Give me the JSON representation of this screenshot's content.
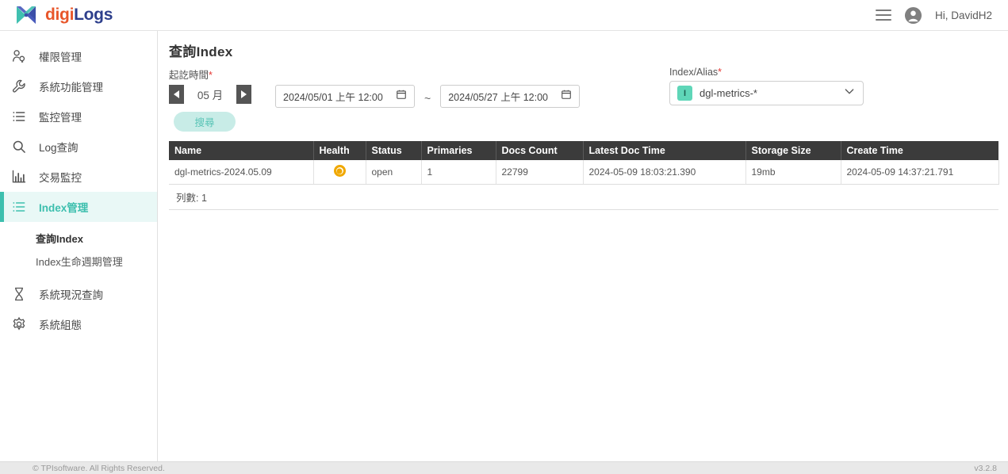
{
  "header": {
    "brand_part1": "digi",
    "brand_part2": "Logs",
    "greeting": "Hi, DavidH2",
    "menu_icon": "hamburger-icon",
    "user_icon": "account-circle-icon"
  },
  "sidebar": {
    "items": [
      {
        "label": "權限管理",
        "icon": "person-key-icon",
        "active": false
      },
      {
        "label": "系統功能管理",
        "icon": "wrench-icon",
        "active": false
      },
      {
        "label": "監控管理",
        "icon": "list-icon",
        "active": false
      },
      {
        "label": "Log查詢",
        "icon": "search-icon",
        "active": false
      },
      {
        "label": "交易監控",
        "icon": "bar-chart-icon",
        "active": false
      },
      {
        "label": "Index管理",
        "icon": "list-icon",
        "active": true
      }
    ],
    "sub_items": [
      {
        "label": "查詢Index",
        "active": true
      },
      {
        "label": "Index生命週期管理",
        "active": false
      }
    ],
    "items_after": [
      {
        "label": "系統現況查詢",
        "icon": "hourglass-icon",
        "active": false
      },
      {
        "label": "系統組態",
        "icon": "gear-icon",
        "active": false
      }
    ]
  },
  "main": {
    "title": "查詢Index",
    "time_label": "起訖時間",
    "required_mark": "*",
    "month_value": "05 月",
    "prev_arrow": "◀",
    "next_arrow": "▶",
    "search_button": "搜尋",
    "date_from": "2024/05/01 上午 12:00",
    "date_to": "2024/05/27 上午 12:00",
    "date_separator": "~",
    "alias_label": "Index/Alias",
    "alias_badge": "I",
    "alias_value": "dgl-metrics-*"
  },
  "table": {
    "columns": [
      "Name",
      "Health",
      "Status",
      "Primaries",
      "Docs Count",
      "Latest Doc Time",
      "Storage Size",
      "Create Time"
    ],
    "rows": [
      {
        "name": "dgl-metrics-2024.05.09",
        "health": "yellow",
        "status": "open",
        "primaries": "1",
        "docs_count": "22799",
        "latest_doc_time": "2024-05-09 18:03:21.390",
        "storage_size": "19mb",
        "create_time": "2024-05-09 14:37:21.791"
      }
    ],
    "count_label": "列數: 1"
  },
  "footer": {
    "copyright": "© TPIsoftware. All Rights Reserved.",
    "version": "v3.2.8"
  },
  "colors": {
    "accent": "#3dbfae",
    "accent_light": "#e9f8f6",
    "brand_orange": "#e8562a",
    "brand_blue": "#2d3f8c",
    "header_dark": "#3b3b3b",
    "health_yellow": "#f0a800",
    "required_red": "#e53935",
    "badge_green": "#5fd6b8"
  }
}
